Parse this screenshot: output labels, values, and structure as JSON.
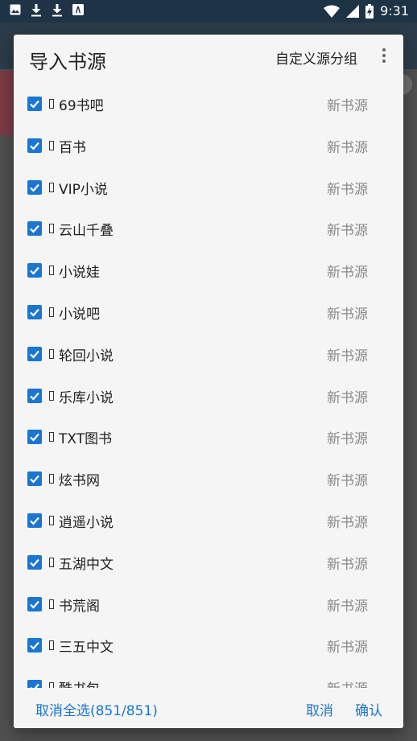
{
  "status_bar": {
    "time": "9:31",
    "left_icons": [
      "image-icon",
      "download-icon",
      "download-icon",
      "a-box-icon"
    ],
    "right_icons": [
      "wifi-icon",
      "signal-icon",
      "battery-charging-icon"
    ]
  },
  "dialog": {
    "title": "导入书源",
    "header_action": "自定义源分组",
    "more_icon": "more-vert-icon",
    "items": [
      {
        "name": "69书吧",
        "group": "新书源",
        "checked": true
      },
      {
        "name": "百书",
        "group": "新书源",
        "checked": true
      },
      {
        "name": "VIP小说",
        "group": "新书源",
        "checked": true
      },
      {
        "name": "云山千叠",
        "group": "新书源",
        "checked": true
      },
      {
        "name": "小说娃",
        "group": "新书源",
        "checked": true
      },
      {
        "name": "小说吧",
        "group": "新书源",
        "checked": true
      },
      {
        "name": "轮回小说",
        "group": "新书源",
        "checked": true
      },
      {
        "name": "乐库小说",
        "group": "新书源",
        "checked": true
      },
      {
        "name": "TXT图书",
        "group": "新书源",
        "checked": true
      },
      {
        "name": "炫书网",
        "group": "新书源",
        "checked": true
      },
      {
        "name": "逍遥小说",
        "group": "新书源",
        "checked": true
      },
      {
        "name": "五湖中文",
        "group": "新书源",
        "checked": true
      },
      {
        "name": "书荒阁",
        "group": "新书源",
        "checked": true
      },
      {
        "name": "三五中文",
        "group": "新书源",
        "checked": true
      },
      {
        "name": "酷书包",
        "group": "新书源",
        "checked": true
      }
    ],
    "footer": {
      "select_toggle": "取消全选(851/851)",
      "cancel": "取消",
      "confirm": "确认"
    }
  },
  "colors": {
    "accent": "#1976d2",
    "status_bar": "#1f3346",
    "dialog_bg": "#f5f5f5"
  }
}
